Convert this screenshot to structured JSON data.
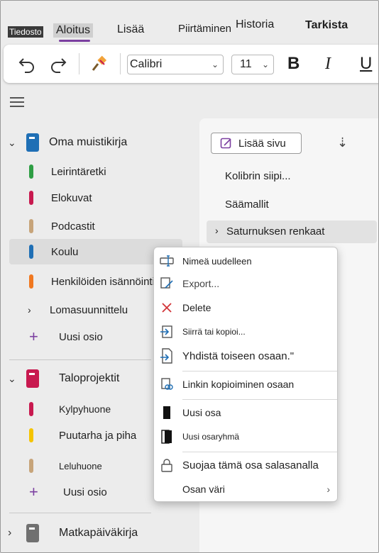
{
  "tabs": {
    "file": "Tiedosto",
    "home": "Aloitus",
    "insert": "Lisää",
    "draw": "Piirtäminen",
    "history": "Historia",
    "review": "Tarkista"
  },
  "ribbon": {
    "font_name": "Calibri",
    "font_size": "11",
    "bold": "B",
    "italic": "I",
    "underline": "U"
  },
  "notebooks": [
    {
      "name": "Oma muistikirja",
      "color": "#1f6fb5",
      "sections": [
        {
          "name": "Leirintäretki",
          "color": "#2e9e44"
        },
        {
          "name": "Elokuvat",
          "color": "#c8194f"
        },
        {
          "name": "Podcastit",
          "color": "#c7a47a"
        },
        {
          "name": "Koulu",
          "color": "#1f6fb5"
        },
        {
          "name": "Henkilöiden isännöinti",
          "color": "#f07820"
        },
        {
          "name": "Lomasuunnittelu",
          "color": ""
        }
      ],
      "add_section": "Uusi osio"
    },
    {
      "name": "Taloprojektit",
      "color": "#c8194f",
      "sections": [
        {
          "name": "Kylpyhuone",
          "color": "#c8194f"
        },
        {
          "name": "Puutarha ja piha",
          "color": "#f5c400"
        },
        {
          "name": "Leluhuone",
          "color": "#c7a47a"
        }
      ],
      "add_section": "Uusi osio"
    },
    {
      "name": "Matkapäiväkirja",
      "color": "#707070"
    }
  ],
  "pages": {
    "add_page": "Lisää sivu",
    "items": [
      "Kolibrin siipi...",
      "Säämallit",
      "Saturnuksen renkaat"
    ]
  },
  "context_menu": {
    "items": [
      {
        "label": "Nimeä uudelleen",
        "icon": "rename-icon"
      },
      {
        "label": "Export...",
        "icon": "export-icon"
      },
      {
        "label": "Delete",
        "icon": "delete-icon"
      },
      {
        "label": "Siirrä tai kopioi...",
        "icon": "move-copy-icon"
      },
      {
        "label": "Yhdistä toiseen osaan.\"",
        "icon": "merge-icon"
      },
      {
        "label": "Linkin kopioiminen osaan",
        "icon": "link-icon"
      },
      {
        "label": "Uusi osa",
        "icon": "new-section-icon"
      },
      {
        "label": "Uusi osaryhmä",
        "icon": "new-section-group-icon"
      },
      {
        "label": "Suojaa tämä osa salasanalla",
        "icon": "lock-icon"
      },
      {
        "label": "Osan väri",
        "icon": "color-icon"
      }
    ]
  },
  "colors": {
    "accent": "#7b3fa0",
    "delete_red": "#d13438"
  }
}
